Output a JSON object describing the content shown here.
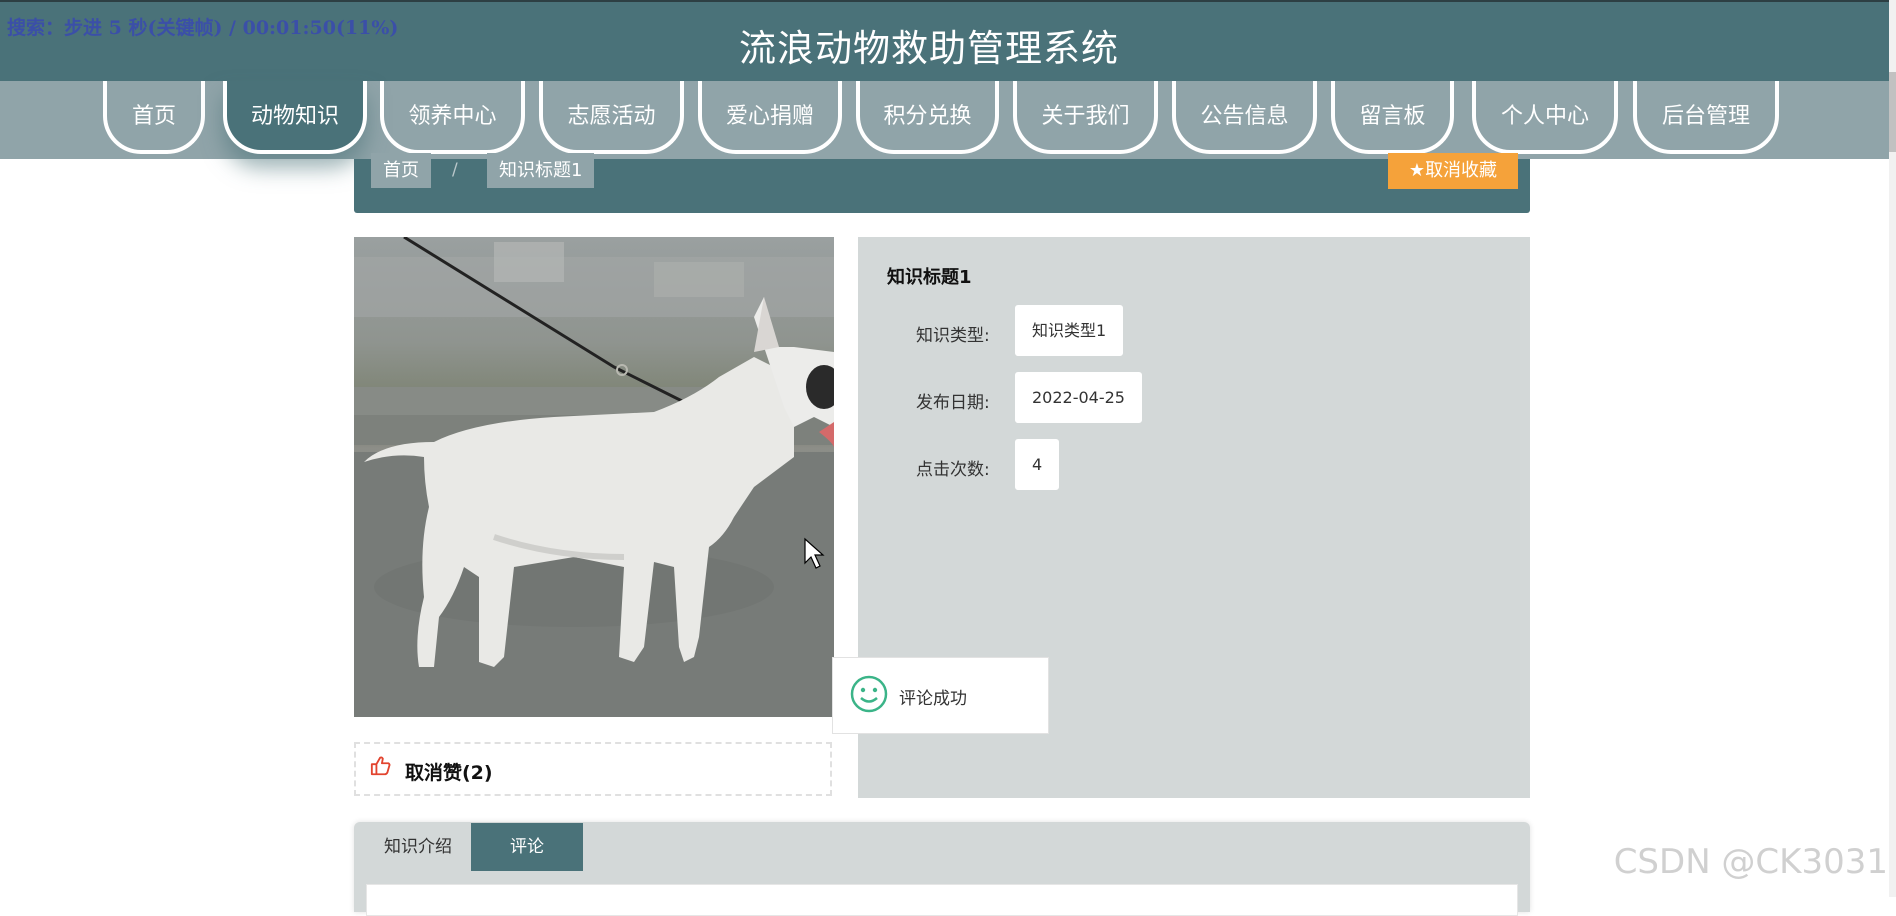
{
  "header": {
    "title": "流浪动物救助管理系统",
    "osd_text": "搜索：步进 5 秒(关键帧) / 00:01:50(11%)"
  },
  "nav": [
    {
      "label": "首页"
    },
    {
      "label": "动物知识",
      "active": true
    },
    {
      "label": "领养中心"
    },
    {
      "label": "志愿活动"
    },
    {
      "label": "爱心捐赠"
    },
    {
      "label": "积分兑换"
    },
    {
      "label": "关于我们"
    },
    {
      "label": "公告信息"
    },
    {
      "label": "留言板"
    },
    {
      "label": "个人中心"
    },
    {
      "label": "后台管理"
    }
  ],
  "breadcrumb": {
    "home": "首页",
    "separator": "/",
    "current": "知识标题1"
  },
  "favorite_button": {
    "icon": "star-icon",
    "label": "取消收藏"
  },
  "like": {
    "icon": "thumbs-up-icon",
    "label": "取消赞(2)"
  },
  "detail": {
    "title": "知识标题1",
    "fields": [
      {
        "label": "知识类型:",
        "value": "知识类型1"
      },
      {
        "label": "发布日期:",
        "value": "2022-04-25"
      },
      {
        "label": "点击次数:",
        "value": "4"
      }
    ]
  },
  "toast": {
    "icon": "smile-icon",
    "message": "评论成功"
  },
  "tabs": [
    {
      "label": "知识介绍",
      "active": false
    },
    {
      "label": "评论",
      "active": true
    }
  ],
  "watermark": "CSDN @CK3031",
  "colors": {
    "primary": "#4a7279",
    "nav_band": "#90a4a9",
    "panel": "#d3d8d8",
    "accent_orange": "#f5a23a",
    "like_red": "#e2442f",
    "toast_green": "#3bb488"
  }
}
